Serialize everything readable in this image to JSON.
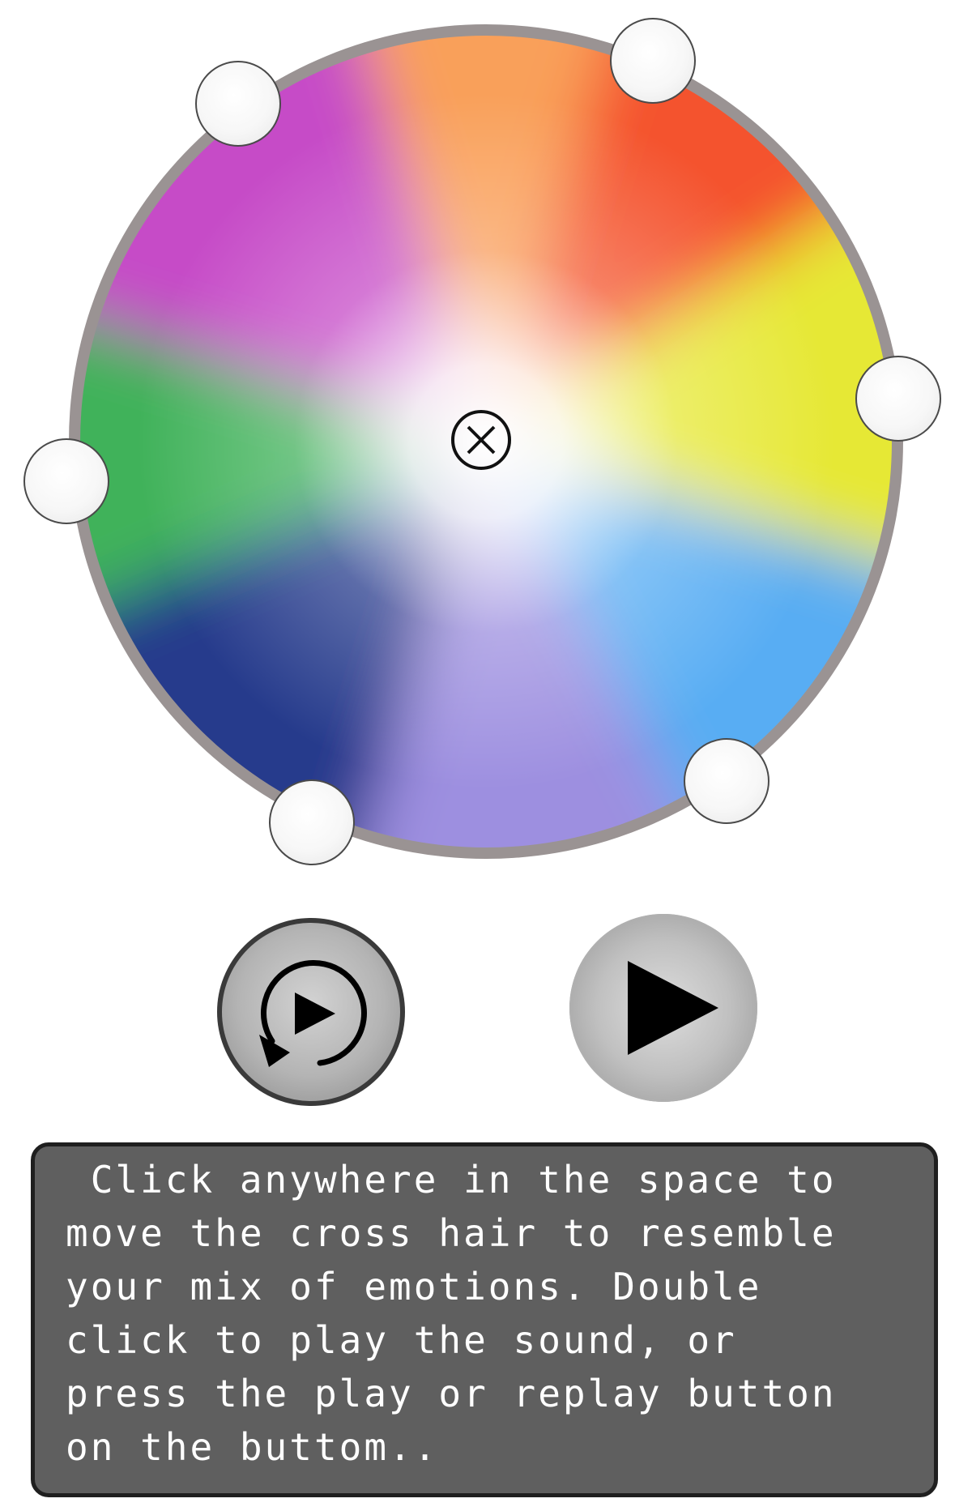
{
  "emotion_wheel": {
    "center_color": "#ffffff",
    "rim_color": "#9a9393",
    "hues": [
      {
        "name": "orange",
        "color": "#f9a05a"
      },
      {
        "name": "red",
        "color": "#f4532e"
      },
      {
        "name": "yellow",
        "color": "#e6e835"
      },
      {
        "name": "sky-blue",
        "color": "#58adf3"
      },
      {
        "name": "lavender",
        "color": "#9d8fe0"
      },
      {
        "name": "navy",
        "color": "#283a8c"
      },
      {
        "name": "green",
        "color": "#41b25a"
      },
      {
        "name": "magenta",
        "color": "#c64bc7"
      }
    ],
    "crosshair_icon": "circled-x-icon"
  },
  "controls": {
    "replay_icon": "replay-icon",
    "play_icon": "play-icon"
  },
  "instructions": {
    "lines": [
      " Click anywhere in the space to",
      "move the cross hair to resemble",
      "your mix of emotions. Double",
      "click to play the sound, or",
      "press the play or replay button",
      "on the buttom.."
    ]
  }
}
